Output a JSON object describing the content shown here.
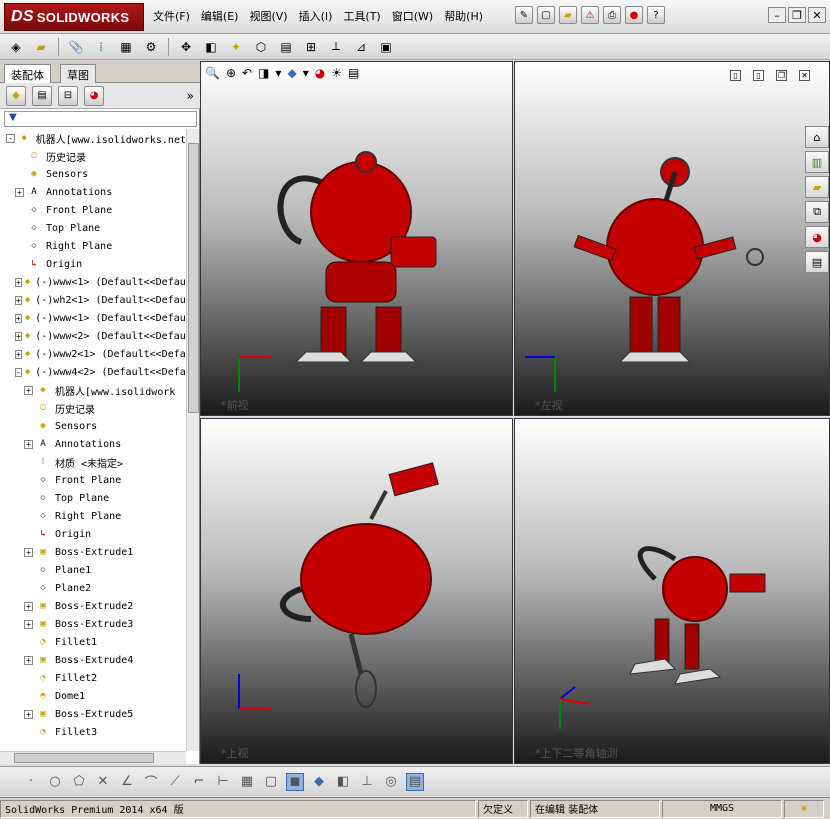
{
  "app": {
    "brand": "SOLIDWORKS",
    "brand_prefix": "DS"
  },
  "menu": [
    "文件(F)",
    "编辑(E)",
    "视图(V)",
    "插入(I)",
    "工具(T)",
    "窗口(W)",
    "帮助(H)"
  ],
  "left_panel": {
    "tabs": [
      "装配体",
      "草图"
    ],
    "active_tab": "装配体",
    "tree": [
      {
        "label": "机器人[www.isolidworks.net",
        "level": 0,
        "icon": "assembly-icon",
        "expand": "-"
      },
      {
        "label": "历史记录",
        "level": 1,
        "icon": "history-icon",
        "expand": ""
      },
      {
        "label": "Sensors",
        "level": 1,
        "icon": "sensor-icon",
        "expand": ""
      },
      {
        "label": "Annotations",
        "level": 1,
        "icon": "annotation-icon",
        "expand": "+"
      },
      {
        "label": "Front Plane",
        "level": 1,
        "icon": "plane-icon",
        "expand": ""
      },
      {
        "label": "Top Plane",
        "level": 1,
        "icon": "plane-icon",
        "expand": ""
      },
      {
        "label": "Right Plane",
        "level": 1,
        "icon": "plane-icon",
        "expand": ""
      },
      {
        "label": "Origin",
        "level": 1,
        "icon": "origin-icon",
        "expand": ""
      },
      {
        "label": "(-)www<1> (Default<<Defaul",
        "level": 1,
        "icon": "subassembly-icon",
        "expand": "+"
      },
      {
        "label": "(-)wh2<1> (Default<<Defaul",
        "level": 1,
        "icon": "subassembly-icon",
        "expand": "+"
      },
      {
        "label": "(-)www<1> (Default<<Defaul",
        "level": 1,
        "icon": "subassembly-icon",
        "expand": "+"
      },
      {
        "label": "(-)www<2> (Default<<Defaul",
        "level": 1,
        "icon": "subassembly-icon",
        "expand": "+"
      },
      {
        "label": "(-)www2<1> (Default<<Defaul",
        "level": 1,
        "icon": "subassembly-icon",
        "expand": "+"
      },
      {
        "label": "(-)www4<2> (Default<<Defaul",
        "level": 1,
        "icon": "subassembly-icon",
        "expand": "-"
      },
      {
        "label": "机器人[www.isolidwork",
        "level": 2,
        "icon": "part-icon",
        "expand": "+"
      },
      {
        "label": "历史记录",
        "level": 2,
        "icon": "history-icon",
        "expand": ""
      },
      {
        "label": "Sensors",
        "level": 2,
        "icon": "sensor-icon",
        "expand": ""
      },
      {
        "label": "Annotations",
        "level": 2,
        "icon": "annotation-icon",
        "expand": "+"
      },
      {
        "label": "材质 <未指定>",
        "level": 2,
        "icon": "material-icon",
        "expand": ""
      },
      {
        "label": "Front Plane",
        "level": 2,
        "icon": "plane-icon",
        "expand": ""
      },
      {
        "label": "Top Plane",
        "level": 2,
        "icon": "plane-icon",
        "expand": ""
      },
      {
        "label": "Right Plane",
        "level": 2,
        "icon": "plane-icon",
        "expand": ""
      },
      {
        "label": "Origin",
        "level": 2,
        "icon": "origin-icon",
        "expand": ""
      },
      {
        "label": "Boss-Extrude1",
        "level": 2,
        "icon": "extrude-icon",
        "expand": "+"
      },
      {
        "label": "Plane1",
        "level": 2,
        "icon": "plane-icon",
        "expand": ""
      },
      {
        "label": "Plane2",
        "level": 2,
        "icon": "plane-icon",
        "expand": ""
      },
      {
        "label": "Boss-Extrude2",
        "level": 2,
        "icon": "extrude-icon",
        "expand": "+"
      },
      {
        "label": "Boss-Extrude3",
        "level": 2,
        "icon": "extrude-icon",
        "expand": "+"
      },
      {
        "label": "Fillet1",
        "level": 2,
        "icon": "fillet-icon",
        "expand": ""
      },
      {
        "label": "Boss-Extrude4",
        "level": 2,
        "icon": "extrude-icon",
        "expand": "+"
      },
      {
        "label": "Fillet2",
        "level": 2,
        "icon": "fillet-icon",
        "expand": ""
      },
      {
        "label": "Dome1",
        "level": 2,
        "icon": "dome-icon",
        "expand": ""
      },
      {
        "label": "Boss-Extrude5",
        "level": 2,
        "icon": "extrude-icon",
        "expand": "+"
      },
      {
        "label": "Fillet3",
        "level": 2,
        "icon": "fillet-icon",
        "expand": ""
      }
    ]
  },
  "viewports": {
    "front": {
      "label": "*前视"
    },
    "left": {
      "label": "*左视"
    },
    "top": {
      "label": "*上视"
    },
    "trimetric": {
      "label": "*上下二等角轴测"
    }
  },
  "status": {
    "product": "SolidWorks Premium 2014 x64 版",
    "state": "欠定义",
    "mode": "在编辑 装配体",
    "units": "MMGS"
  },
  "colors": {
    "robot_red": "#d40000",
    "accent_blue": "#3a6ab0"
  }
}
